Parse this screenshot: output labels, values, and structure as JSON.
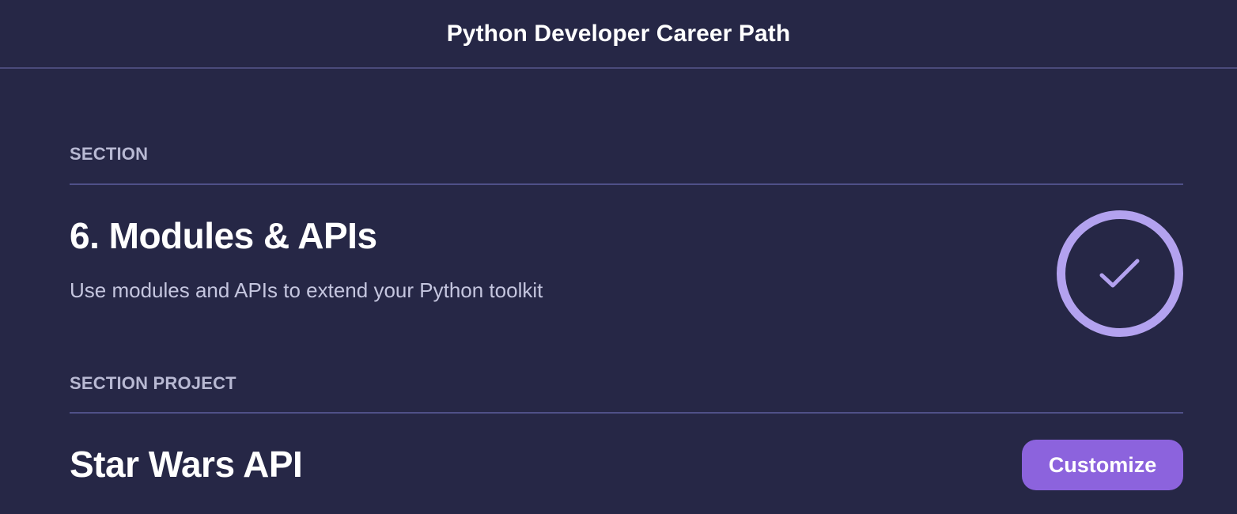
{
  "header": {
    "title": "Python Developer Career Path"
  },
  "section": {
    "label": "SECTION",
    "title": "6. Modules & APIs",
    "description": "Use modules and APIs to extend your Python toolkit",
    "status_icon": "check-icon",
    "status": "completed"
  },
  "section_project": {
    "label": "SECTION PROJECT",
    "title": "Star Wars API",
    "customize_label": "Customize"
  },
  "colors": {
    "background": "#262746",
    "accent": "#8c63dd",
    "badge_ring": "#b3a2ef",
    "divider": "#4f5088"
  }
}
